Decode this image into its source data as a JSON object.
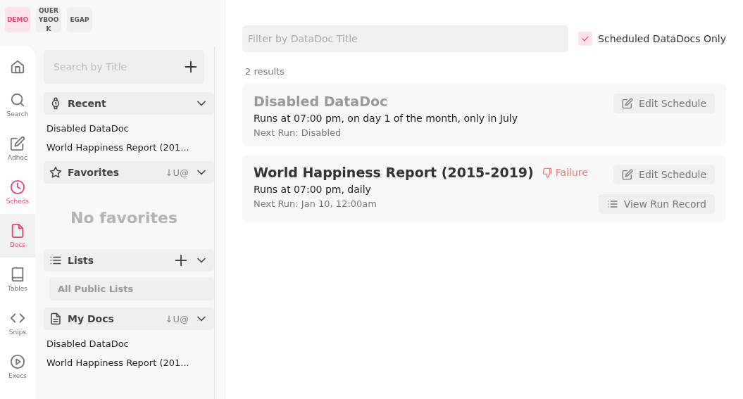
{
  "environments": [
    {
      "label": "DEMO",
      "selected": true
    },
    {
      "label": "QUERYBOOK",
      "selected": false
    },
    {
      "label": "EGAP",
      "selected": false
    }
  ],
  "nav": [
    {
      "kind": "home",
      "active": false,
      "open": false
    },
    {
      "kind": "search",
      "label": "Search",
      "active": false,
      "open": false
    },
    {
      "kind": "adhoc",
      "label": "Adhoc",
      "active": false,
      "open": false
    },
    {
      "kind": "clock",
      "label": "Scheds",
      "active": true,
      "open": false
    },
    {
      "kind": "doc",
      "label": "Docs",
      "active": true,
      "open": true
    },
    {
      "kind": "book",
      "label": "Tables",
      "active": false,
      "open": false
    },
    {
      "kind": "code",
      "label": "Snips",
      "active": false,
      "open": false
    },
    {
      "kind": "play",
      "label": "Execs",
      "active": false,
      "open": false
    }
  ],
  "sidebar": {
    "search": {
      "placeholder": "Search by Title"
    },
    "sections": [
      {
        "kind": "recent",
        "title": "Recent",
        "add": false,
        "expanded": true,
        "items": [
          "Disabled DataDoc",
          "World Happiness Report (201..."
        ]
      },
      {
        "kind": "favorites",
        "title": "Favorites",
        "sort": "↓U@",
        "add": false,
        "expanded": true,
        "empty": "No favorites"
      },
      {
        "kind": "lists",
        "title": "Lists",
        "add": true,
        "expanded": true,
        "list_items": [
          "All Public Lists"
        ]
      },
      {
        "kind": "mydocs",
        "title": "My Docs",
        "sort": "↓U@",
        "add": false,
        "expanded": true,
        "items": [
          "Disabled DataDoc",
          "World Happiness Report (201..."
        ]
      }
    ]
  },
  "filter": {
    "placeholder": "Filter by DataDoc Title",
    "checkbox": {
      "label": "Scheduled DataDocs Only",
      "checked": true
    }
  },
  "result_count": "2 results",
  "results": [
    {
      "title": "Disabled DataDoc",
      "disabled": true,
      "schedule": "Runs at 07:00 pm, on day 1 of the month, only in July",
      "next_run": "Next Run: Disabled",
      "buttons": [
        "Edit Schedule"
      ]
    },
    {
      "title": "World Happiness Report (2015-2019)",
      "disabled": false,
      "status": "Failure",
      "schedule": "Runs at 07:00 pm, daily",
      "next_run": "Next Run: Jan 10, 12:00am",
      "buttons": [
        "Edit Schedule",
        "View Run Record"
      ]
    }
  ]
}
